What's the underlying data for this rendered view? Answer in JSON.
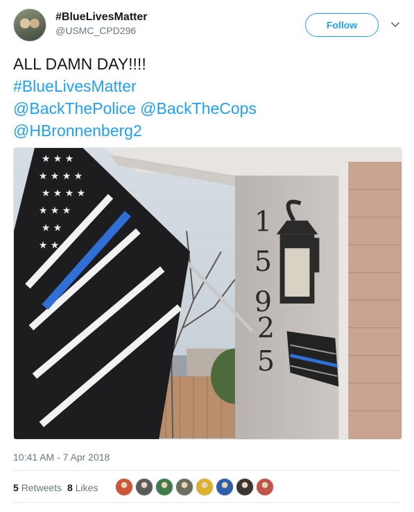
{
  "header": {
    "display_name": "#BlueLivesMatter",
    "handle": "@USMC_CPD296",
    "follow_label": "Follow"
  },
  "tweet": {
    "text_plain": "ALL DAMN DAY!!!!",
    "hashtag": "#BlueLivesMatter",
    "mention_1": "@BackThePolice",
    "mention_2": "@BackTheCops",
    "mention_3": "@HBronnenberg2"
  },
  "photo": {
    "house_numbers": [
      "1",
      "5",
      "9",
      "2",
      "5"
    ]
  },
  "meta": {
    "timestamp": "10:41 AM - 7 Apr 2018"
  },
  "stats": {
    "retweets_count": "5",
    "retweets_label": "Retweets",
    "likes_count": "8",
    "likes_label": "Likes"
  },
  "likers": [
    {
      "name": "liker-avatar-1",
      "color": "#c9573a"
    },
    {
      "name": "liker-avatar-2",
      "color": "#5a5a5a"
    },
    {
      "name": "liker-avatar-3",
      "color": "#3f7a4a"
    },
    {
      "name": "liker-avatar-4",
      "color": "#6b6f5c"
    },
    {
      "name": "liker-avatar-5",
      "color": "#d8b22a"
    },
    {
      "name": "liker-avatar-6",
      "color": "#2f5fa8"
    },
    {
      "name": "liker-avatar-7",
      "color": "#3a3530"
    },
    {
      "name": "liker-avatar-8",
      "color": "#c0544a"
    }
  ],
  "colors": {
    "accent": "#1da1f2",
    "secondary_text": "#657786",
    "divider": "#e6ecf0"
  }
}
